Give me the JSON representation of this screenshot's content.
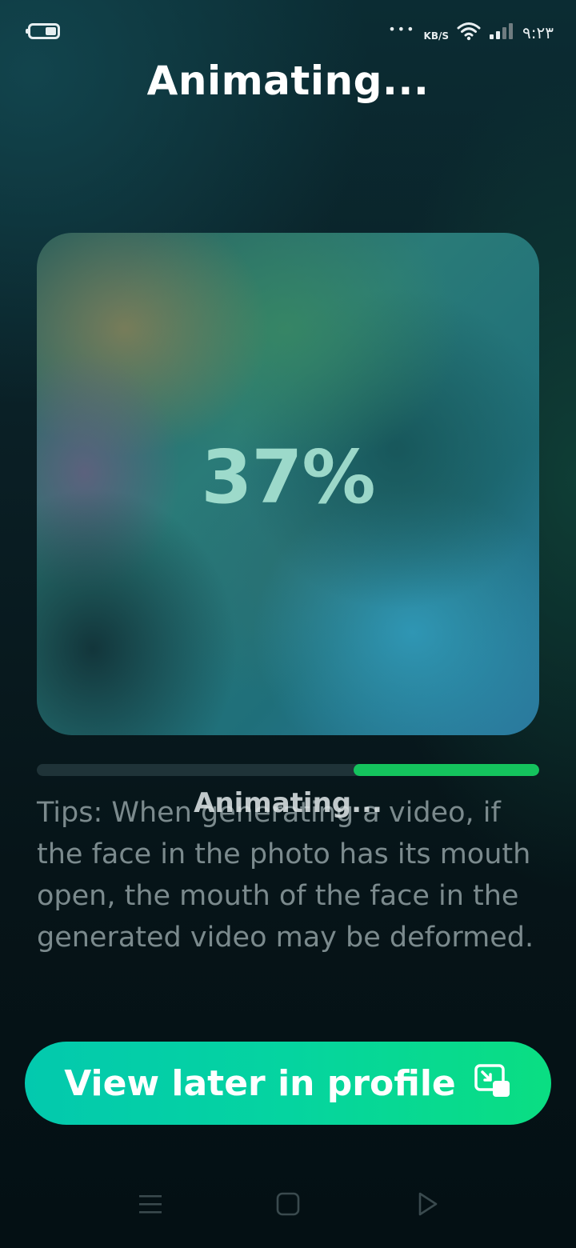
{
  "status_bar": {
    "network_speed": "KB/S",
    "time": "٩:٢٣",
    "icons": [
      "battery-icon",
      "dots-icon",
      "wifi-icon",
      "signal-icon"
    ]
  },
  "header": {
    "title": "Animating..."
  },
  "preview": {
    "percent_label": "37%"
  },
  "progress": {
    "value": 0.37,
    "track_color": "#1f3338",
    "fill_color": "#14c35d"
  },
  "status_overlay": "Animating...",
  "tips": {
    "text": "Tips: When generating a video, if the face in the photo has its mouth open, the mouth of the face in the generated video may be deformed."
  },
  "primary_button": {
    "label": "View later in profile",
    "icon": "picture-in-picture-icon"
  },
  "nav_bar": {
    "icons": [
      "menu-icon",
      "home-icon",
      "back-icon"
    ]
  },
  "colors": {
    "accent_start": "#03c9ae",
    "accent_end": "#0ade82",
    "progress_green": "#14c35d",
    "tips_gray": "#7b8a8d"
  }
}
